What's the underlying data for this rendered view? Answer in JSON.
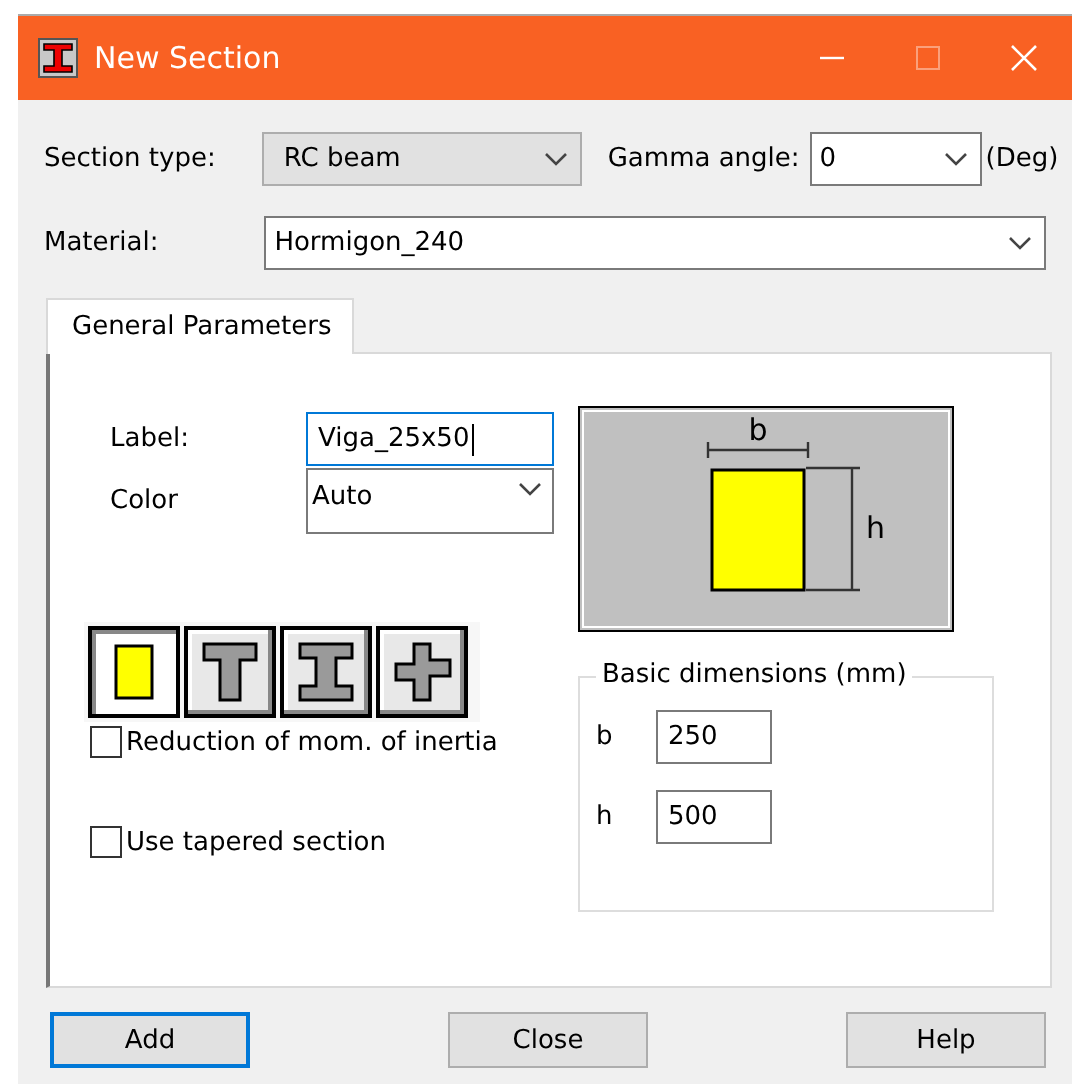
{
  "window": {
    "title": "New Section"
  },
  "section_type": {
    "label": "Section type:",
    "value": "RC beam",
    "disabled": true
  },
  "gamma_angle": {
    "label": "Gamma angle:",
    "value": "0",
    "unit": "(Deg)"
  },
  "material": {
    "label": "Material:",
    "value": "Hormigon_240"
  },
  "tabs": [
    {
      "label": "General Parameters",
      "selected": true
    }
  ],
  "label_field": {
    "label": "Label:",
    "value": "Viga_25x50"
  },
  "color_field": {
    "label": "Color",
    "value": "Auto"
  },
  "shapes": [
    {
      "kind": "rectangle",
      "selected": true
    },
    {
      "kind": "tee",
      "selected": false
    },
    {
      "kind": "ibeam",
      "selected": false
    },
    {
      "kind": "cross",
      "selected": false
    }
  ],
  "checkboxes": [
    {
      "label": "Reduction of mom. of inertia",
      "checked": false
    },
    {
      "label": "Use tapered section",
      "checked": false
    }
  ],
  "preview": {
    "width_label": "b",
    "height_label": "h"
  },
  "basic_dimensions": {
    "title": "Basic dimensions (mm)",
    "fields": [
      {
        "label": "b",
        "value": "250"
      },
      {
        "label": "h",
        "value": "500"
      }
    ]
  },
  "buttons": [
    {
      "label": "Add",
      "focused": true
    },
    {
      "label": "Close",
      "focused": false
    },
    {
      "label": "Help",
      "focused": false
    }
  ]
}
